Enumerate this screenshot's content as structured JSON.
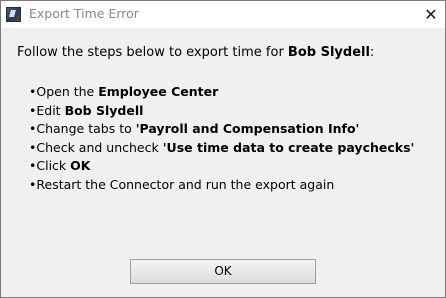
{
  "window": {
    "title": "Export Time Error",
    "close_glyph": "✕"
  },
  "intro": {
    "prefix": "Follow the steps below to export time for ",
    "employee": "Bob Slydell",
    "suffix": ":"
  },
  "steps": [
    {
      "bullet": "•",
      "text": "Open the ",
      "bold": "Employee Center",
      "after": ""
    },
    {
      "bullet": "•",
      "text": "Edit ",
      "bold": "Bob Slydell",
      "after": ""
    },
    {
      "bullet": "•",
      "text": "Change tabs to ",
      "bold": "'Payroll and Compensation Info'",
      "after": ""
    },
    {
      "bullet": "•",
      "text": "Check and uncheck ",
      "bold": "'Use time data to create paychecks'",
      "after": ""
    },
    {
      "bullet": "•",
      "text": "Click ",
      "bold": "OK",
      "after": ""
    },
    {
      "bullet": "•",
      "text": "Restart the Connector and run the export again",
      "bold": "",
      "after": ""
    }
  ],
  "buttons": {
    "ok_label": "OK"
  },
  "icons": {
    "app": "app-icon",
    "close": "close-icon"
  }
}
